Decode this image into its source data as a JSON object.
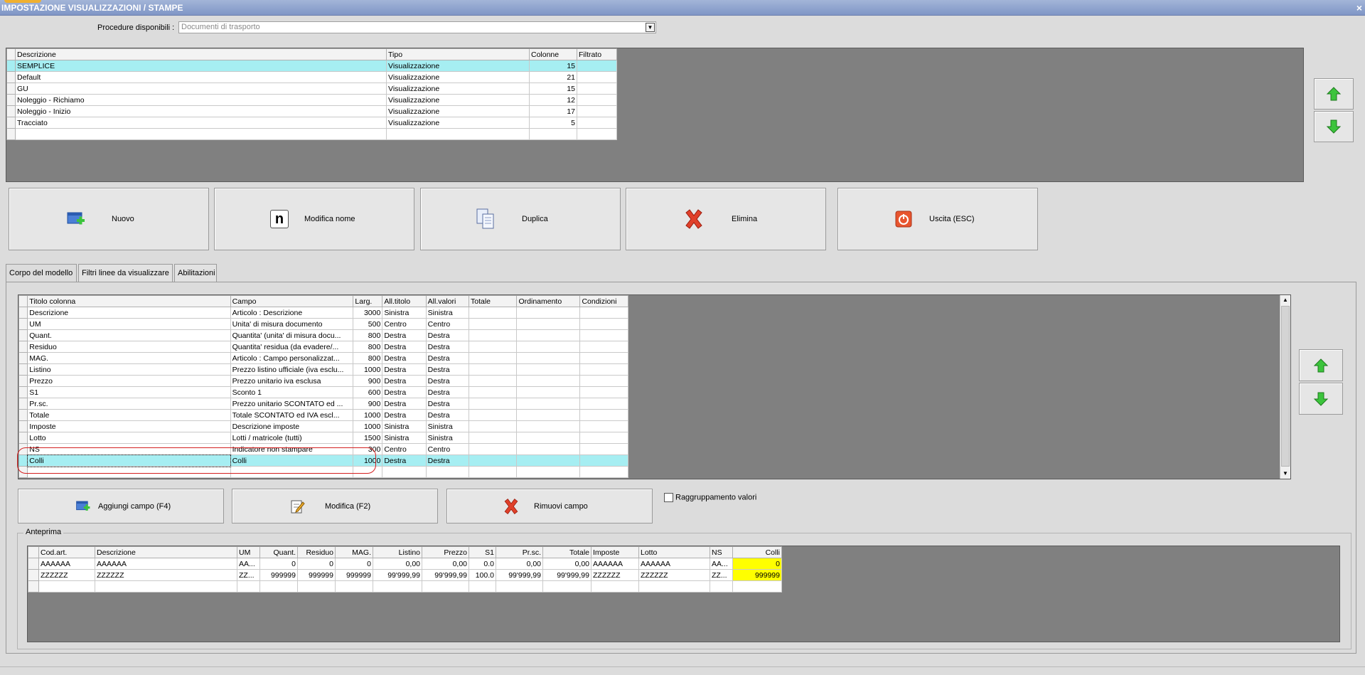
{
  "window": {
    "title": "IMPOSTAZIONE VISUALIZZAZIONI / STAMPE",
    "close_glyph": "×"
  },
  "procedure": {
    "label": "Procedure disponibili :",
    "value": "Documenti di trasporto"
  },
  "models_grid": {
    "columns": [
      "Descrizione",
      "Tipo",
      "Colonne",
      "Filtrato"
    ],
    "rows": [
      {
        "descrizione": "SEMPLICE",
        "tipo": "Visualizzazione",
        "colonne": "15",
        "filtrato": ""
      },
      {
        "descrizione": "Default",
        "tipo": "Visualizzazione",
        "colonne": "21",
        "filtrato": ""
      },
      {
        "descrizione": "GU",
        "tipo": "Visualizzazione",
        "colonne": "15",
        "filtrato": ""
      },
      {
        "descrizione": "Noleggio - Richiamo",
        "tipo": "Visualizzazione",
        "colonne": "12",
        "filtrato": ""
      },
      {
        "descrizione": "Noleggio - Inizio",
        "tipo": "Visualizzazione",
        "colonne": "17",
        "filtrato": ""
      },
      {
        "descrizione": "Tracciato",
        "tipo": "Visualizzazione",
        "colonne": "5",
        "filtrato": ""
      }
    ],
    "selected_index": 0
  },
  "toolbar": {
    "nuovo": "Nuovo",
    "modifica_nome": "Modifica nome",
    "duplica": "Duplica",
    "elimina": "Elimina",
    "uscita": "Uscita (ESC)",
    "n_glyph": "n"
  },
  "tabs": [
    {
      "label": "Corpo del modello",
      "active": true
    },
    {
      "label": "Filtri linee da visualizzare",
      "active": false
    },
    {
      "label": "Abilitazioni",
      "active": false
    }
  ],
  "fields_grid": {
    "columns": [
      "Titolo colonna",
      "Campo",
      "Larg.",
      "All.titolo",
      "All.valori",
      "Totale",
      "Ordinamento",
      "Condizioni"
    ],
    "rows": [
      {
        "titolo": "Descrizione",
        "campo": "Articolo : Descrizione",
        "larg": "3000",
        "all_titolo": "Sinistra",
        "all_valori": "Sinistra"
      },
      {
        "titolo": "UM",
        "campo": "Unita' di misura documento",
        "larg": "500",
        "all_titolo": "Centro",
        "all_valori": "Centro"
      },
      {
        "titolo": "Quant.",
        "campo": "Quantita' (unita' di misura docu...",
        "larg": "800",
        "all_titolo": "Destra",
        "all_valori": "Destra"
      },
      {
        "titolo": "Residuo",
        "campo": "Quantita' residua (da evadere/...",
        "larg": "800",
        "all_titolo": "Destra",
        "all_valori": "Destra"
      },
      {
        "titolo": "MAG.",
        "campo": "Articolo : Campo personalizzat...",
        "larg": "800",
        "all_titolo": "Destra",
        "all_valori": "Destra"
      },
      {
        "titolo": "Listino",
        "campo": "Prezzo listino ufficiale (iva esclu...",
        "larg": "1000",
        "all_titolo": "Destra",
        "all_valori": "Destra"
      },
      {
        "titolo": "Prezzo",
        "campo": "Prezzo unitario iva esclusa",
        "larg": "900",
        "all_titolo": "Destra",
        "all_valori": "Destra"
      },
      {
        "titolo": "S1",
        "campo": "Sconto 1",
        "larg": "600",
        "all_titolo": "Destra",
        "all_valori": "Destra"
      },
      {
        "titolo": "Pr.sc.",
        "campo": "Prezzo unitario SCONTATO ed ...",
        "larg": "900",
        "all_titolo": "Destra",
        "all_valori": "Destra"
      },
      {
        "titolo": "Totale",
        "campo": "Totale SCONTATO ed IVA escl...",
        "larg": "1000",
        "all_titolo": "Destra",
        "all_valori": "Destra"
      },
      {
        "titolo": "Imposte",
        "campo": "Descrizione imposte",
        "larg": "1000",
        "all_titolo": "Sinistra",
        "all_valori": "Sinistra"
      },
      {
        "titolo": "Lotto",
        "campo": "Lotti / matricole (tutti)",
        "larg": "1500",
        "all_titolo": "Sinistra",
        "all_valori": "Sinistra"
      },
      {
        "titolo": "NS",
        "campo": "Indicatore non stampare",
        "larg": "300",
        "all_titolo": "Centro",
        "all_valori": "Centro"
      },
      {
        "titolo": "Colli",
        "campo": "Colli",
        "larg": "1000",
        "all_titolo": "Destra",
        "all_valori": "Destra"
      }
    ],
    "selected_index": 13
  },
  "field_buttons": {
    "aggiungi": "Aggiungi campo (F4)",
    "modifica": "Modifica (F2)",
    "rimuovi": "Rimuovi campo"
  },
  "raggruppamento": {
    "label": "Raggruppamento valori",
    "checked": false
  },
  "preview": {
    "legend": "Anteprima",
    "columns": [
      "Cod.art.",
      "Descrizione",
      "UM",
      "Quant.",
      "Residuo",
      "MAG.",
      "Listino",
      "Prezzo",
      "S1",
      "Pr.sc.",
      "Totale",
      "Imposte",
      "Lotto",
      "NS",
      "Colli"
    ],
    "rows": [
      [
        "AAAAAA",
        "AAAAAA",
        "AA...",
        "0",
        "0",
        "0",
        "0,00",
        "0,00",
        "0.0",
        "0,00",
        "0,00",
        "AAAAAA",
        "AAAAAA",
        "AA...",
        "0"
      ],
      [
        "ZZZZZZ",
        "ZZZZZZ",
        "ZZ...",
        "999999",
        "999999",
        "999999",
        "99'999,99",
        "99'999,99",
        "100.0",
        "99'999,99",
        "99'999,99",
        "ZZZZZZ",
        "ZZZZZZ",
        "ZZ...",
        "999999"
      ]
    ]
  },
  "colors": {
    "selection": "#a6eef2",
    "highlight_column": "#ffff00",
    "annotation": "#d42020",
    "arrow_green": "#3cc43c"
  },
  "icons": {
    "nuovo": "add-window-icon",
    "modifica_nome": "rename-icon",
    "duplica": "duplicate-icon",
    "elimina": "delete-x-icon",
    "uscita": "power-icon",
    "aggiungi": "add-window-icon",
    "modifica": "edit-note-icon",
    "rimuovi": "delete-x-icon",
    "up": "arrow-up-icon",
    "down": "arrow-down-icon"
  }
}
